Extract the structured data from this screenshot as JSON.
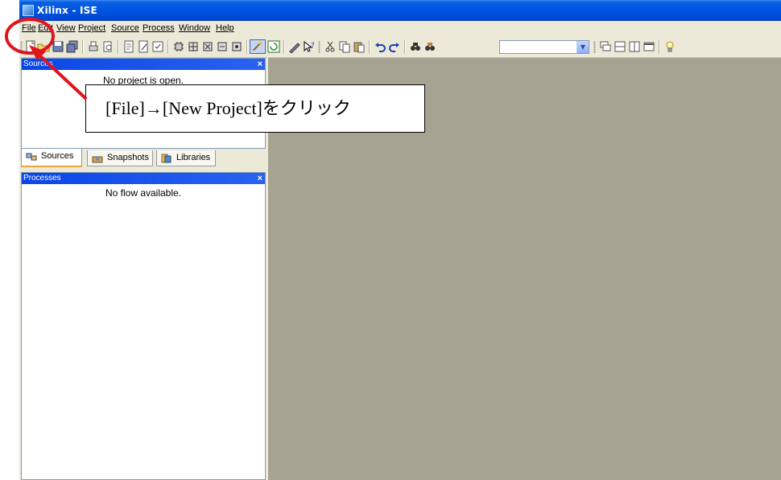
{
  "window": {
    "title": "Xilinx - ISE"
  },
  "menubar": {
    "items": [
      "File",
      "Edit",
      "View",
      "Project",
      "Source",
      "Process",
      "Window",
      "Help"
    ]
  },
  "toolbar": {
    "combo_value": ""
  },
  "sources_pane": {
    "title": "Sources",
    "close": "×",
    "message": "No project is open."
  },
  "tabs": [
    {
      "label": "Sources",
      "icon": "sources-icon",
      "selected": true
    },
    {
      "label": "Snapshots",
      "icon": "snapshots-icon",
      "selected": false
    },
    {
      "label": "Libraries",
      "icon": "libraries-icon",
      "selected": false
    }
  ],
  "processes_pane": {
    "title": "Processes",
    "close": "×",
    "message": "No flow available."
  },
  "annotation": {
    "callout_text": "[File]→[New Project]をクリック",
    "highlight_color": "#e0141e"
  },
  "colors": {
    "titlebar": "#0054e3",
    "workspace": "#a7a393",
    "pane_header": "#0a46e6",
    "tab_accent": "#e8a33d"
  }
}
